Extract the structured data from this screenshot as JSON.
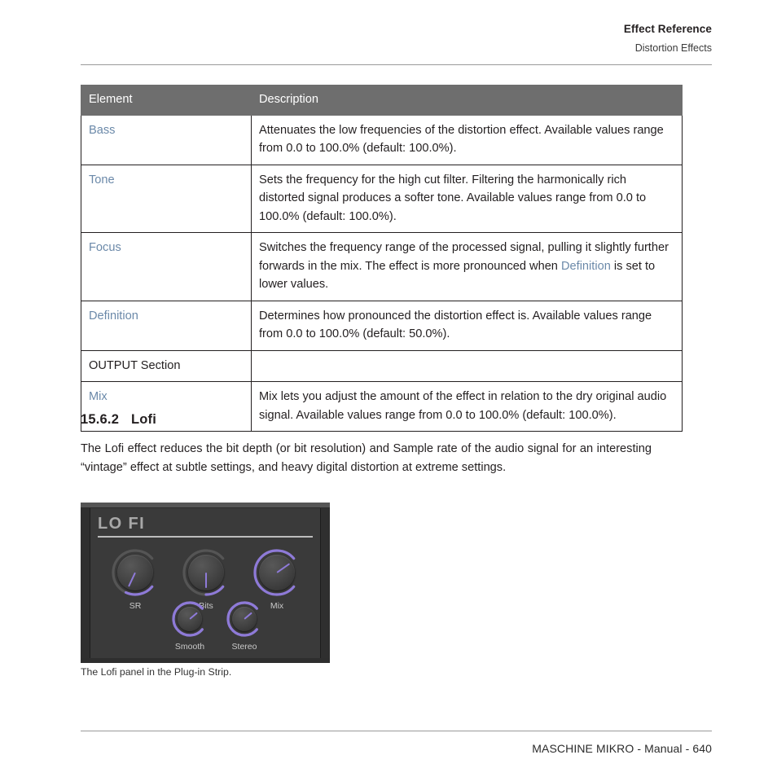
{
  "header": {
    "title": "Effect Reference",
    "subtitle": "Distortion Effects"
  },
  "table": {
    "columns": [
      "Element",
      "Description"
    ],
    "rows": [
      {
        "element": "Bass",
        "element_style": "link",
        "description": "Attenuates the low frequencies of the distortion effect. Available values range from 0.0 to 100.0% (default: 100.0%)."
      },
      {
        "element": "Tone",
        "element_style": "link",
        "description": "Sets the frequency for the high cut filter. Filtering the harmonically rich distorted signal produces a softer tone. Available values range from 0.0 to 100.0% (default: 100.0%)."
      },
      {
        "element": "Focus",
        "element_style": "link",
        "description_part1": "Switches the frequency range of the processed signal, pulling it slightly further forwards in the mix. The effect is more pronounced when ",
        "description_link": "Definition",
        "description_part2": " is set to lower values."
      },
      {
        "element": "Definition",
        "element_style": "link",
        "description": "Determines how pronounced the distortion effect is. Available values range from 0.0 to 100.0% (default: 50.0%)."
      },
      {
        "element": "OUTPUT Section",
        "element_style": "bold",
        "description": ""
      },
      {
        "element": "Mix",
        "element_style": "link",
        "description": "Mix lets you adjust the amount of the effect in relation to the dry original audio signal. Available values range from 0.0 to 100.0% (default: 100.0%)."
      }
    ]
  },
  "section": {
    "number": "15.6.2",
    "title": "Lofi",
    "paragraph": "The Lofi effect reduces the bit depth (or bit resolution) and Sample rate of the audio signal for an interesting “vintage” effect at subtle settings, and heavy digital distortion at extreme settings."
  },
  "plugin_panel": {
    "title": "LO FI",
    "knobs": [
      {
        "label": "SR",
        "angle": 205,
        "arc_end": 205
      },
      {
        "label": "Bits",
        "angle": 180,
        "arc_end": 180
      },
      {
        "label": "Mix",
        "angle": 55,
        "arc_end": 55
      },
      {
        "label": "Smooth",
        "angle": 50,
        "arc_end": 50
      },
      {
        "label": "Stereo",
        "angle": 50,
        "arc_end": 50
      }
    ],
    "accent_color": "#8e7ad8",
    "track_color": "#5a5a5a",
    "body_color": "#3a3a3a"
  },
  "caption": "The Lofi panel in the Plug-in Strip.",
  "footer": "MASCHINE MIKRO - Manual - 640"
}
